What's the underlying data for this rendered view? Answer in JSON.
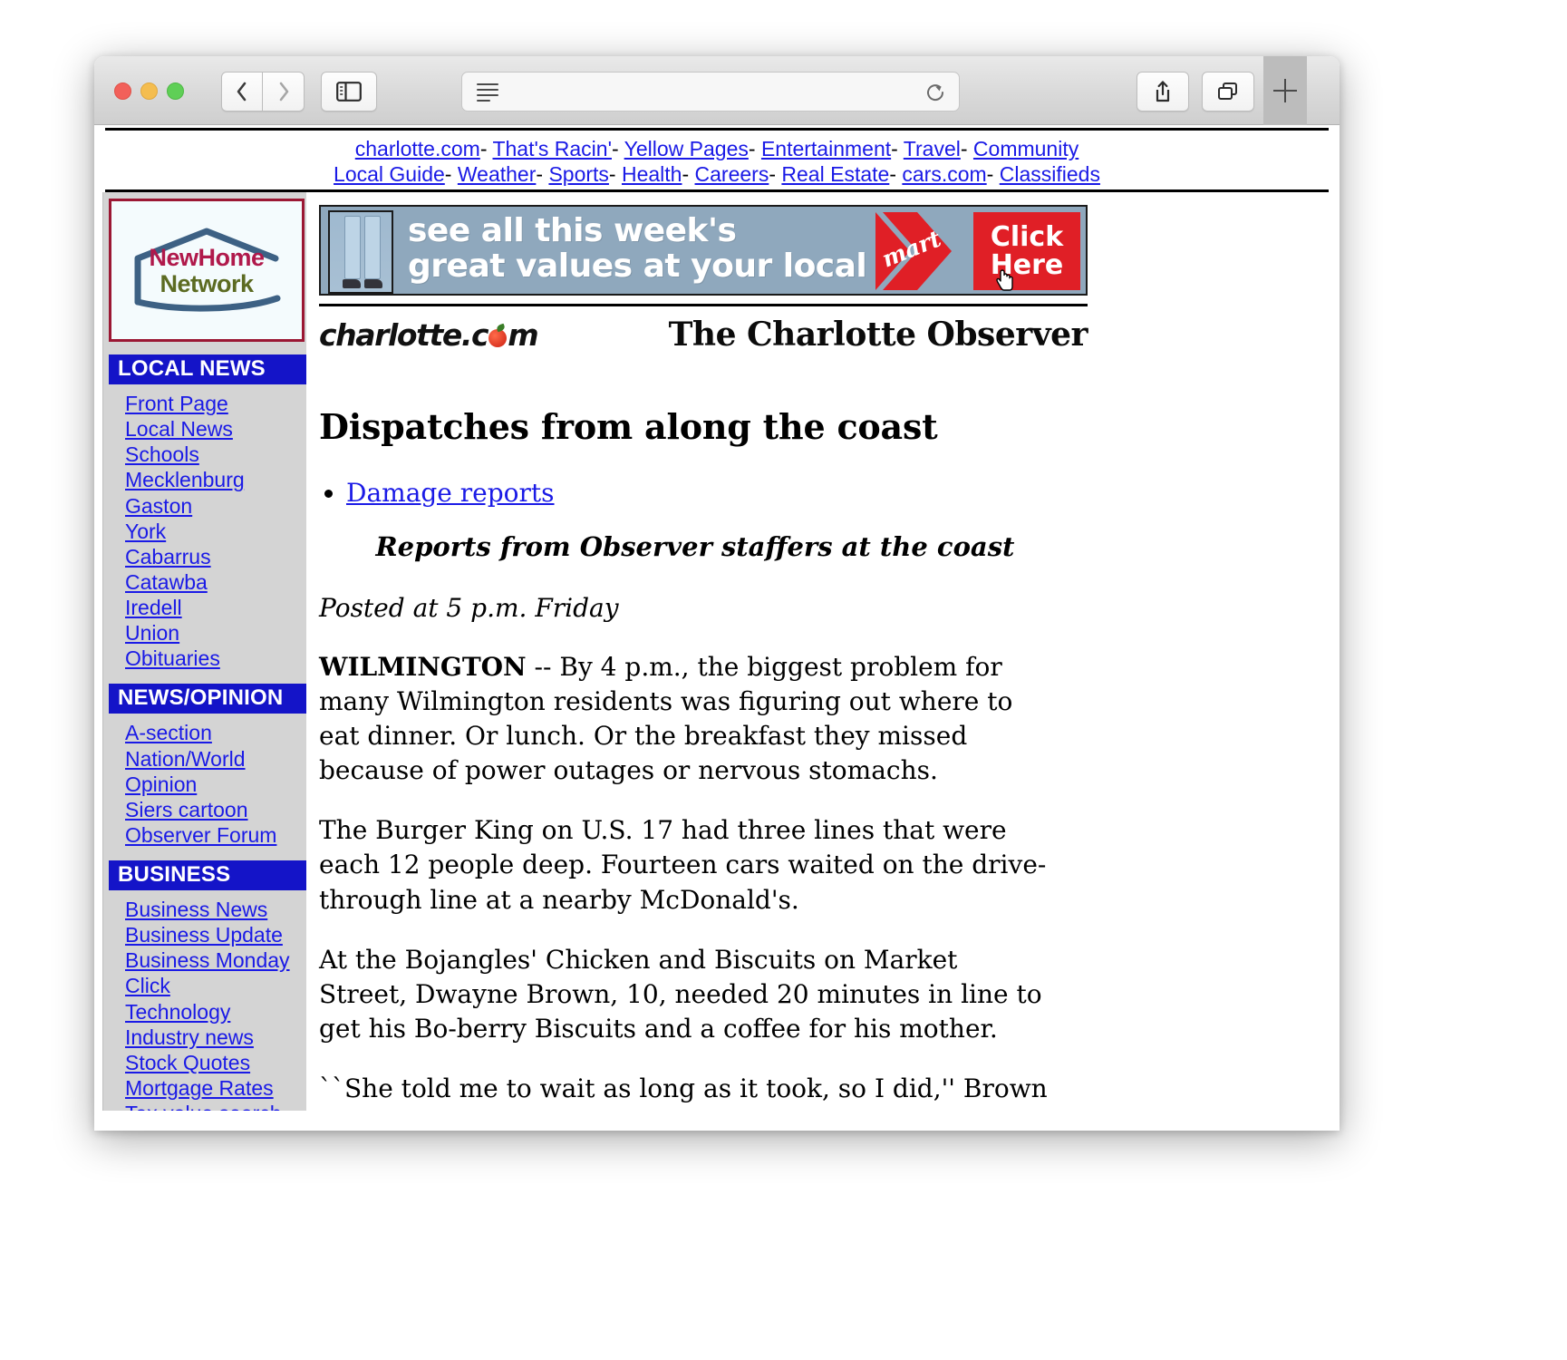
{
  "browser": {
    "traffic_lights": [
      "close",
      "minimize",
      "maximize"
    ],
    "back_label": "Back",
    "forward_label": "Forward",
    "sidebar_label": "Show Sidebar",
    "url_value": "",
    "url_placeholder": "",
    "reader_label": "Reader View",
    "reload_label": "Reload",
    "share_label": "Share",
    "tabs_label": "Show Tab Overview",
    "newtab_label": "+"
  },
  "topnav": {
    "row1": [
      "charlotte.com",
      "That's Racin'",
      "Yellow Pages",
      "Entertainment",
      "Travel",
      "Community"
    ],
    "row2": [
      "Local Guide",
      "Weather",
      "Sports",
      "Health",
      "Careers",
      "Real Estate",
      "cars.com",
      "Classifieds"
    ],
    "separator": "-"
  },
  "sidebar": {
    "logo": {
      "line1": "NewHome",
      "line2": "Network"
    },
    "sections": [
      {
        "title": "LOCAL NEWS",
        "items": [
          "Front Page",
          "Local News",
          "Schools",
          "Mecklenburg",
          "Gaston",
          "York",
          "Cabarrus",
          "Catawba",
          "Iredell",
          "Union",
          "Obituaries"
        ]
      },
      {
        "title": "NEWS/OPINION",
        "items": [
          "A-section",
          "Nation/World",
          "Opinion",
          "Siers cartoon",
          "Observer Forum"
        ]
      },
      {
        "title": "BUSINESS",
        "items": [
          "Business News",
          "Business Update",
          "Business Monday",
          "Click",
          "Technology",
          "Industry news",
          "Stock Quotes",
          "Mortgage Rates",
          "Tax value search"
        ]
      }
    ]
  },
  "banner_ad": {
    "line1": "see all this week's",
    "line2": "great values at your local",
    "brand_k": "K",
    "brand_mart": "mart",
    "cta_line1": "Click",
    "cta_line2": "Here",
    "bg_color": "#8fa8bd",
    "cta_color": "#e01f26"
  },
  "masthead": {
    "site_logo_pre": "charlotte.c",
    "site_logo_post": "m",
    "paper_title": "The Charlotte Observer"
  },
  "article": {
    "headline": "Dispatches from along the coast",
    "bullets": [
      "Damage reports"
    ],
    "subhead": "Reports from Observer staffers at the coast",
    "posted": "Posted at 5 p.m. Friday",
    "dateline": "WILMINGTON",
    "paragraphs": [
      " -- By 4 p.m., the biggest problem for many Wilmington residents was figuring out where to eat dinner. Or lunch. Or the breakfast they missed because of power outages or nervous stomachs.",
      "The Burger King on U.S. 17 had three lines that were each 12 people deep. Fourteen cars waited on the drive-through line at a nearby McDonald's.",
      "At the Bojangles' Chicken and Biscuits on Market Street, Dwayne Brown, 10, needed 20 minutes in line to get his Bo-berry Biscuits and a coffee for his mother.",
      "``She told me to wait as long as it took, so I did,'' Brown said. ``She"
    ]
  }
}
